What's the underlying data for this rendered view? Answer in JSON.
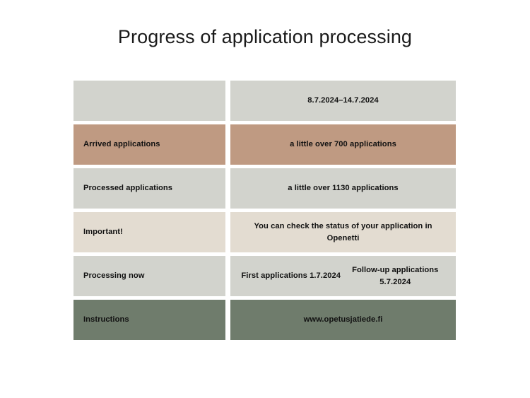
{
  "title": "Progress of application processing",
  "colors": {
    "gray": "#d2d3cd",
    "tan": "#bf9a82",
    "beige": "#e3dcd1",
    "green": "#6f7c6c",
    "background": "#ffffff",
    "text": "#111111"
  },
  "table": {
    "rows": [
      {
        "label": "",
        "value": "8.7.2024–14.7.2024",
        "color": "gray"
      },
      {
        "label": "Arrived applications",
        "value": "a little over 700 applications",
        "color": "tan"
      },
      {
        "label": "Processed applications",
        "value": "a little over 1130 applications",
        "color": "gray"
      },
      {
        "label": "Important!",
        "value": "You can check the status of your application in Openetti",
        "color": "beige"
      },
      {
        "label": "Processing now",
        "value_line1": "First applications 1.7.2024",
        "value_line2": "Follow-up applications 5.7.2024",
        "color": "gray"
      },
      {
        "label": "Instructions",
        "value": "www.opetusjatiede.fi",
        "color": "green"
      }
    ]
  }
}
